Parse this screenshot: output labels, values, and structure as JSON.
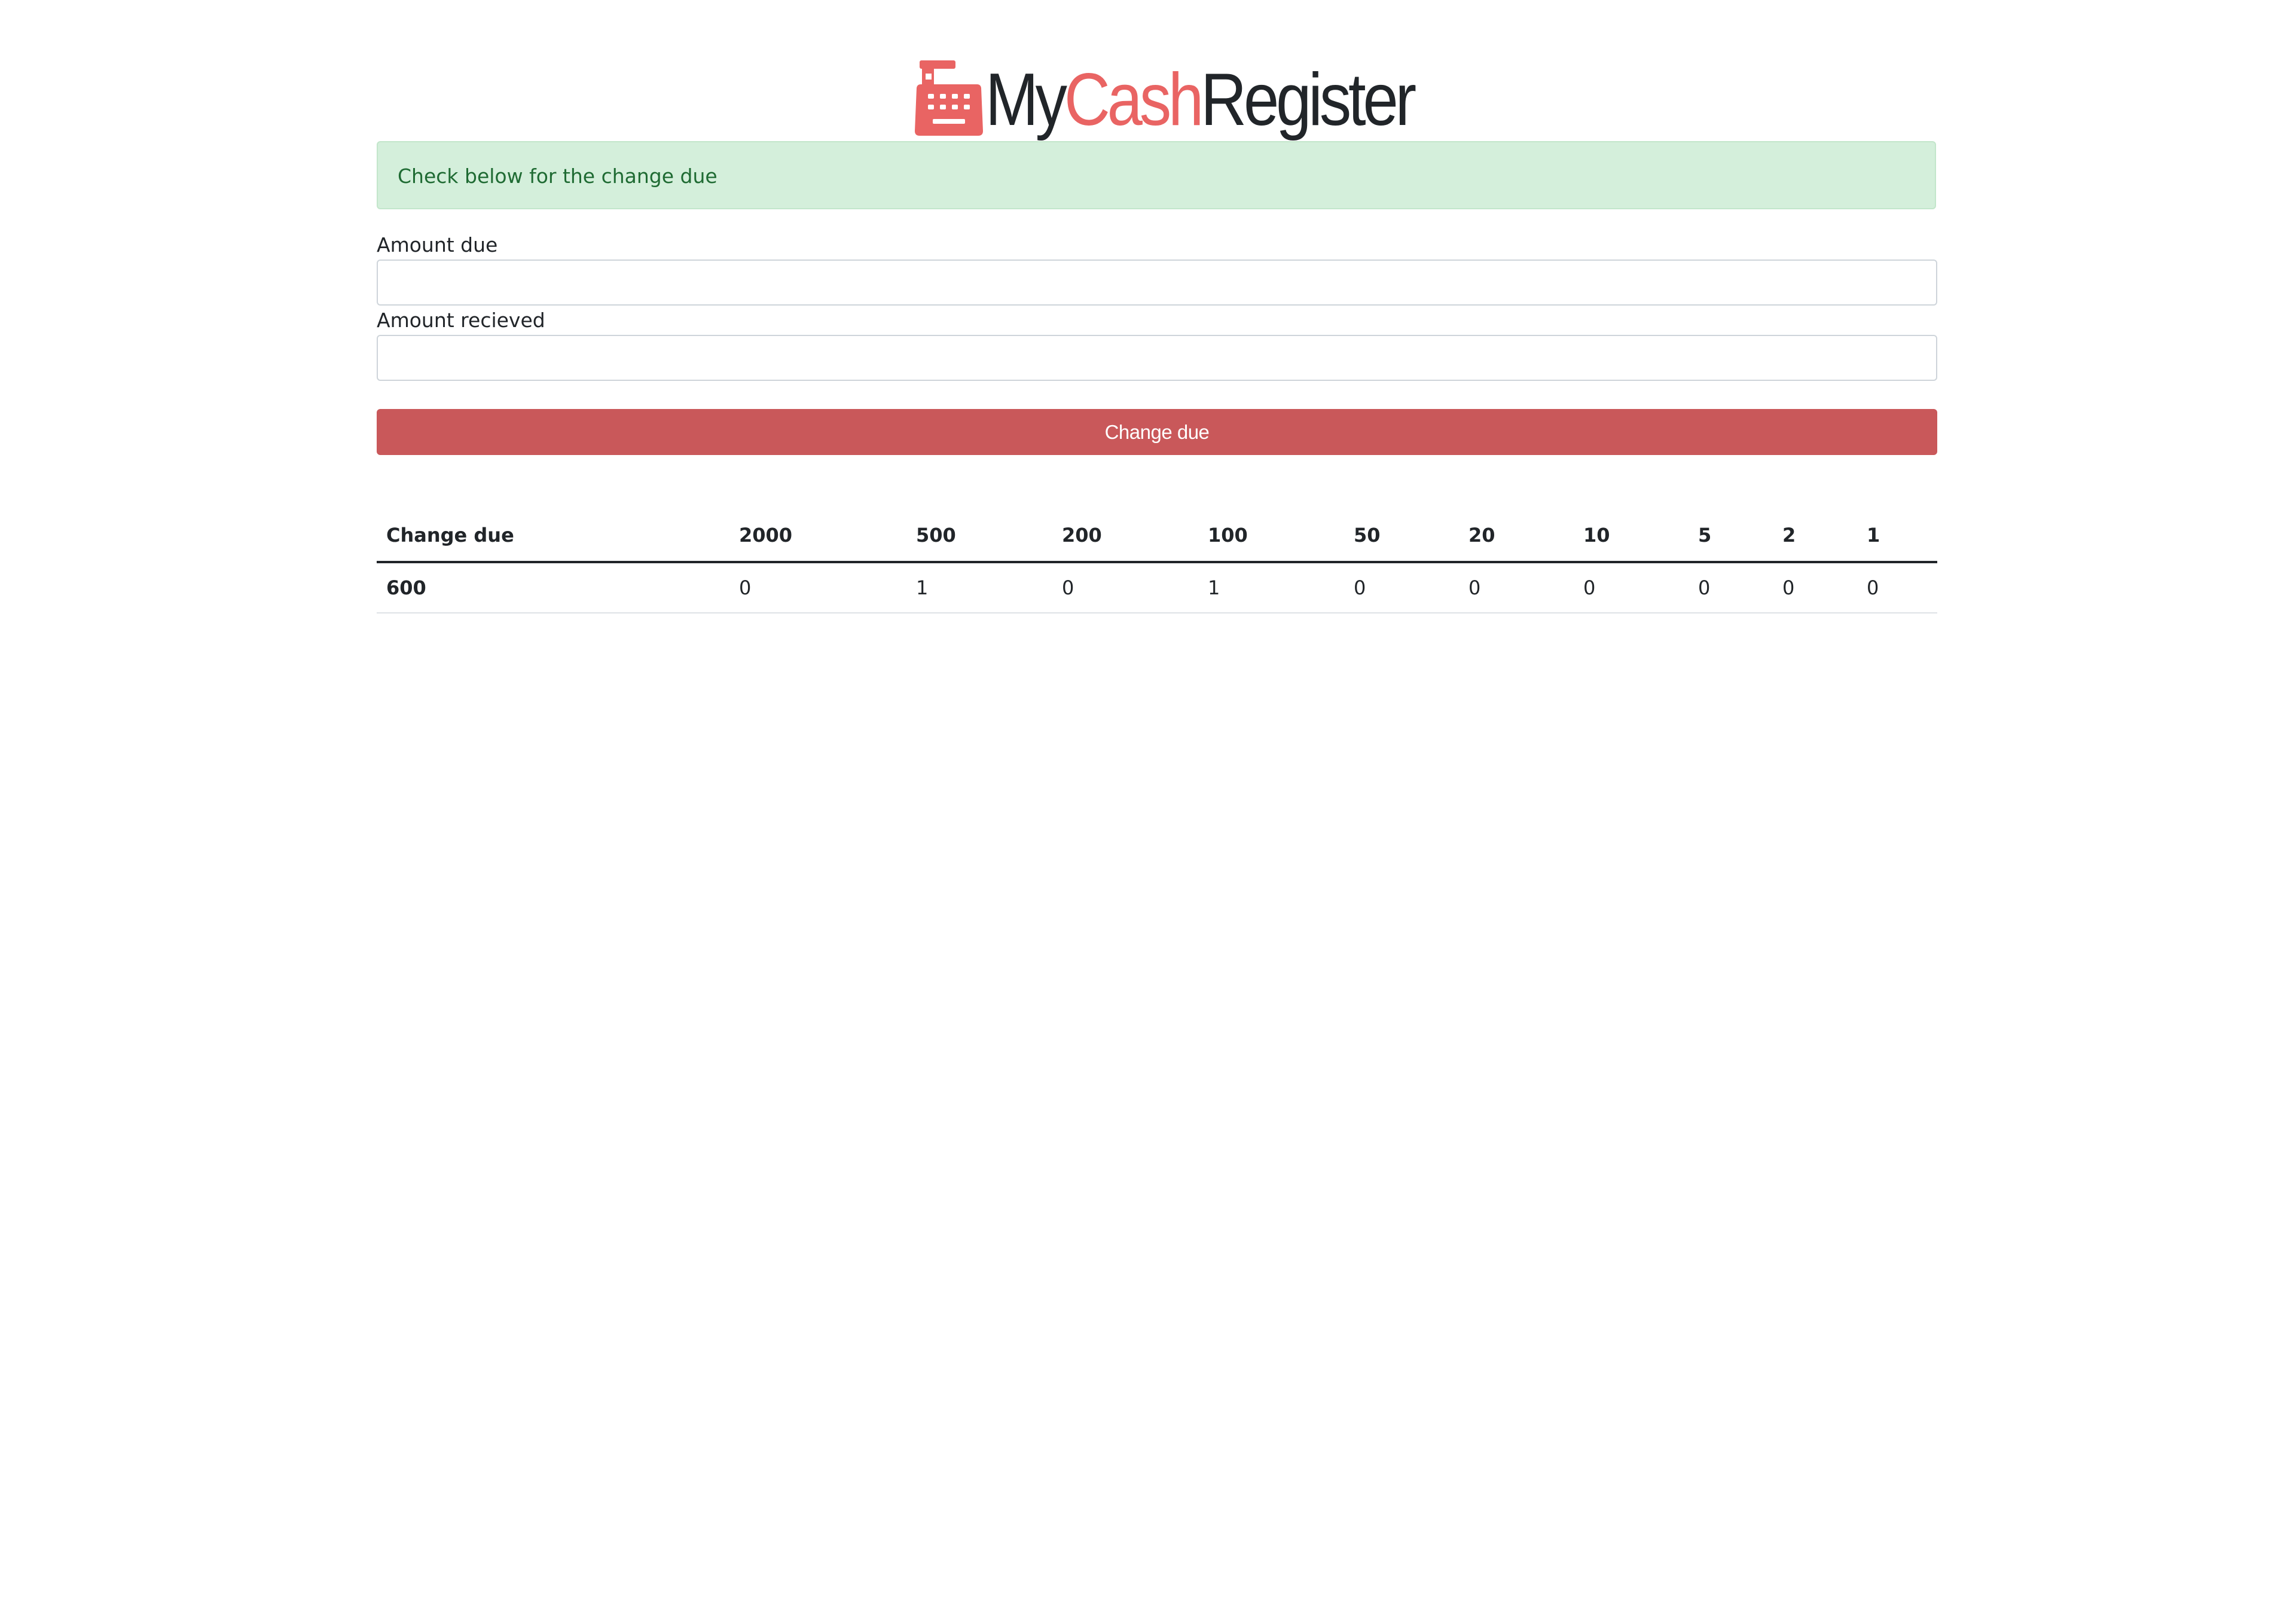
{
  "brand": {
    "part_my": "My",
    "part_cash": "Cash",
    "part_register": "Register",
    "icon": "cash-register-icon",
    "accent_color": "#e96463"
  },
  "alert": {
    "message": "Check below for the change due",
    "color": "#d4efdb"
  },
  "form": {
    "amount_due_label": "Amount due",
    "amount_due_value": "",
    "amount_received_label": "Amount recieved",
    "amount_received_value": "",
    "submit_label": "Change due",
    "submit_color": "#c9585a"
  },
  "table": {
    "headers": [
      "Change due",
      "2000",
      "500",
      "200",
      "100",
      "50",
      "20",
      "10",
      "5",
      "2",
      "1"
    ],
    "rows": [
      [
        "600",
        "0",
        "1",
        "0",
        "1",
        "0",
        "0",
        "0",
        "0",
        "0",
        "0"
      ]
    ]
  }
}
